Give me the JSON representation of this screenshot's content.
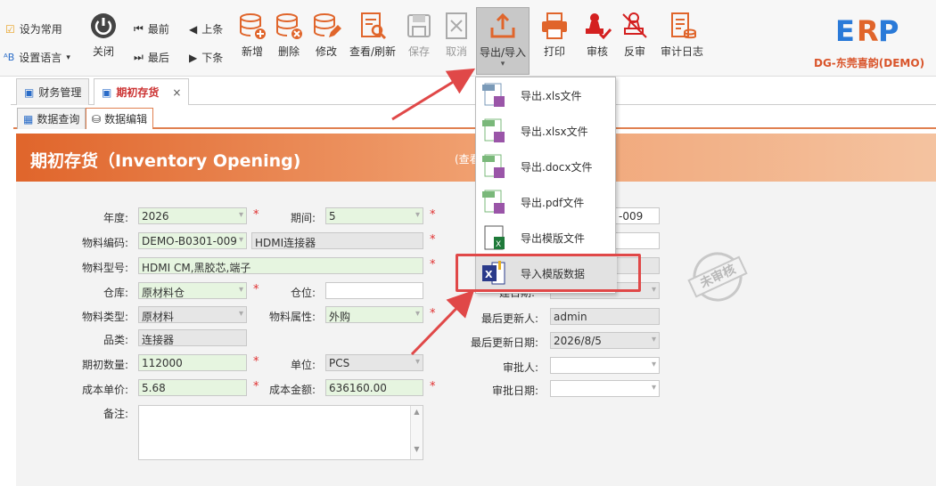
{
  "toolbar": {
    "set_common": "设为常用",
    "set_language": "设置语言",
    "close": "关闭",
    "first": "最前",
    "last": "最后",
    "prev": "上条",
    "next": "下条",
    "add": "新增",
    "delete": "删除",
    "edit": "修改",
    "view_refresh": "查看/刷新",
    "save": "保存",
    "cancel": "取消",
    "export_import": "导出/导入",
    "print": "打印",
    "audit": "审核",
    "unaudit": "反审",
    "audit_log": "审计日志",
    "company": "DG-东莞喜韵(DEMO)",
    "logo_text": "ERP"
  },
  "tabs": [
    {
      "label": "财务管理"
    },
    {
      "label": "期初存货",
      "close": "×"
    }
  ],
  "subtabs": [
    {
      "label": "数据查询"
    },
    {
      "label": "数据编辑"
    }
  ],
  "banner": {
    "title": "期初存货（Inventory Opening)",
    "subtitle": "(查看"
  },
  "form": {
    "year_label": "年度:",
    "year": "2026",
    "period_label": "期间:",
    "period": "5",
    "material_code_label": "物料编码:",
    "material_code": "DEMO-B0301-009",
    "material_name": "HDMI连接器",
    "material_model_label": "物料型号:",
    "material_model": "HDMI CM,黑胶芯,端子",
    "warehouse_label": "仓库:",
    "warehouse": "原材料仓",
    "location_label": "仓位:",
    "location": "",
    "material_type_label": "物料类型:",
    "material_type": "原材料",
    "material_attr_label": "物料属性:",
    "material_attr": "外购",
    "category_label": "品类:",
    "category": "连接器",
    "opening_qty_label": "期初数量:",
    "opening_qty": "112000",
    "unit_label": "单位:",
    "unit": "PCS",
    "unit_cost_label": "成本单价:",
    "unit_cost": "5.68",
    "total_cost_label": "成本金额:",
    "total_cost": "636160.00",
    "remark_label": "备注:",
    "right_code": "-009",
    "creator_date_label": "建日期:",
    "last_updater_label": "最后更新人:",
    "last_updater": "admin",
    "last_update_date_label": "最后更新日期:",
    "last_update_date": "2026/8/5",
    "approver_label": "审批人:",
    "approver": "",
    "approve_date_label": "审批日期:",
    "approve_date": "",
    "stamp": "未审核"
  },
  "export_menu": [
    {
      "label": "导出.xls文件",
      "icon": "xls-file-icon"
    },
    {
      "label": "导出.xlsx文件",
      "icon": "xlsx-file-icon"
    },
    {
      "label": "导出.docx文件",
      "icon": "docx-file-icon"
    },
    {
      "label": "导出.pdf文件",
      "icon": "pdf-file-icon"
    },
    {
      "label": "导出模版文件",
      "icon": "excel-template-icon"
    },
    {
      "label": "导入模版数据",
      "icon": "excel-import-icon"
    }
  ],
  "colors": {
    "accent": "#e0652b",
    "required": "#e03030",
    "highlight_box": "#e04848"
  }
}
